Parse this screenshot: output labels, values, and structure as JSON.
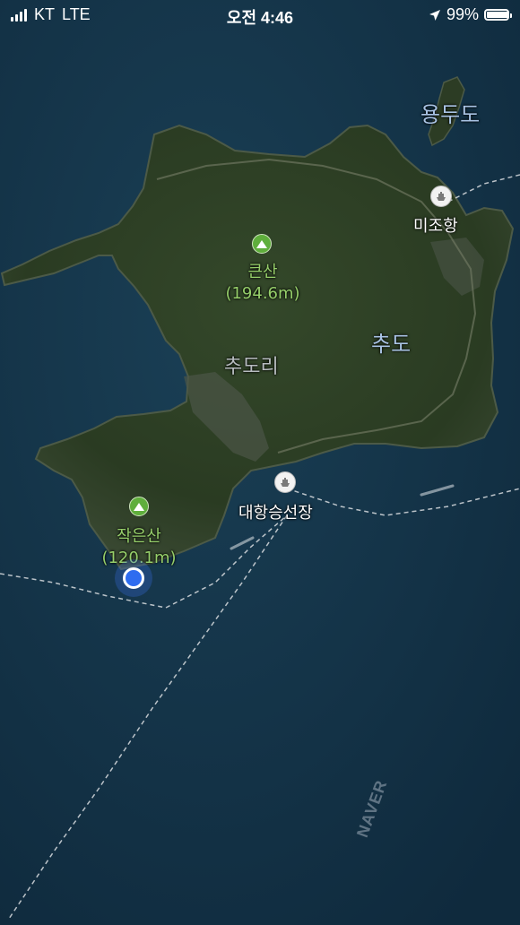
{
  "status_bar": {
    "carrier": "KT",
    "network": "LTE",
    "time": "오전 4:46",
    "battery_text": "99%",
    "battery_level": 0.99,
    "signal_bars": 4,
    "icons": [
      "signal-icon",
      "location-arrow-icon",
      "battery-icon"
    ]
  },
  "map": {
    "island_labels": {
      "yongdudo": "용두도",
      "chudo": "추도"
    },
    "village_label": "추도리",
    "ports": {
      "mijohang": "미조항",
      "daehang": "대항승선장"
    },
    "peaks": {
      "big": {
        "name": "큰산",
        "height": "(194.6m)"
      },
      "small": {
        "name": "작은산",
        "height": "(120.1m)"
      }
    },
    "watermark": "NAVER",
    "colors": {
      "sea": "#13344a",
      "land": "#2b3d21",
      "peak_green": "#96cf6a",
      "location_blue": "#2e6cf0"
    }
  }
}
